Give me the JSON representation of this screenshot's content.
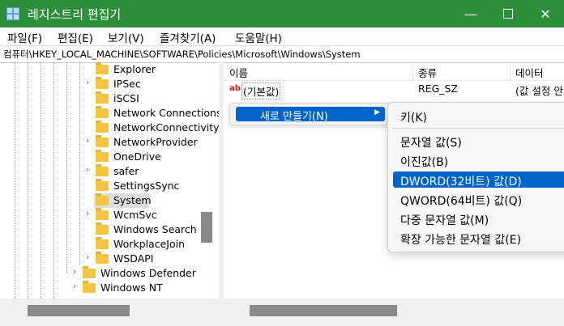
{
  "window": {
    "title": "레지스트리 편집기"
  },
  "menu": [
    "파일(F)",
    "편집(E)",
    "보기(V)",
    "즐겨찾기(A)",
    "도움말(H)"
  ],
  "address": "컴퓨터\\HKEY_LOCAL_MACHINE\\SOFTWARE\\Policies\\Microsoft\\Windows\\System",
  "tree": {
    "items": [
      {
        "label": "Explorer",
        "expandable": false
      },
      {
        "label": "IPSec",
        "expandable": true
      },
      {
        "label": "iSCSI",
        "expandable": false
      },
      {
        "label": "Network Connections",
        "expandable": false
      },
      {
        "label": "NetworkConnectivityStatusIndicator",
        "expandable": false
      },
      {
        "label": "NetworkProvider",
        "expandable": true
      },
      {
        "label": "OneDrive",
        "expandable": false
      },
      {
        "label": "safer",
        "expandable": true
      },
      {
        "label": "SettingsSync",
        "expandable": false
      },
      {
        "label": "System",
        "expandable": false,
        "selected": true
      },
      {
        "label": "WcmSvc",
        "expandable": true
      },
      {
        "label": "Windows Search",
        "expandable": false
      },
      {
        "label": "WorkplaceJoin",
        "expandable": false
      },
      {
        "label": "WSDAPI",
        "expandable": true
      }
    ],
    "parent_items": [
      {
        "label": "Windows Defender",
        "expandable": true
      },
      {
        "label": "Windows NT",
        "expandable": true
      }
    ]
  },
  "list": {
    "columns": [
      "이름",
      "종류",
      "데이터"
    ],
    "rows": [
      {
        "name": "(기본값)",
        "type": "REG_SZ",
        "data": "(값 설정 안 됨)"
      }
    ]
  },
  "context_menu": {
    "item": "새로 만들기(N)",
    "submenu": [
      "키(K)",
      "문자열 값(S)",
      "이진값(B)",
      "DWORD(32비트) 값(D)",
      "QWORD(64비트) 값(Q)",
      "다중 문자열 값(M)",
      "확장 가능한 문자열 값(E)"
    ],
    "highlighted": "DWORD(32비트) 값(D)"
  },
  "colors": {
    "titlebar": "#2e8f3a",
    "highlight": "#0064c8"
  }
}
